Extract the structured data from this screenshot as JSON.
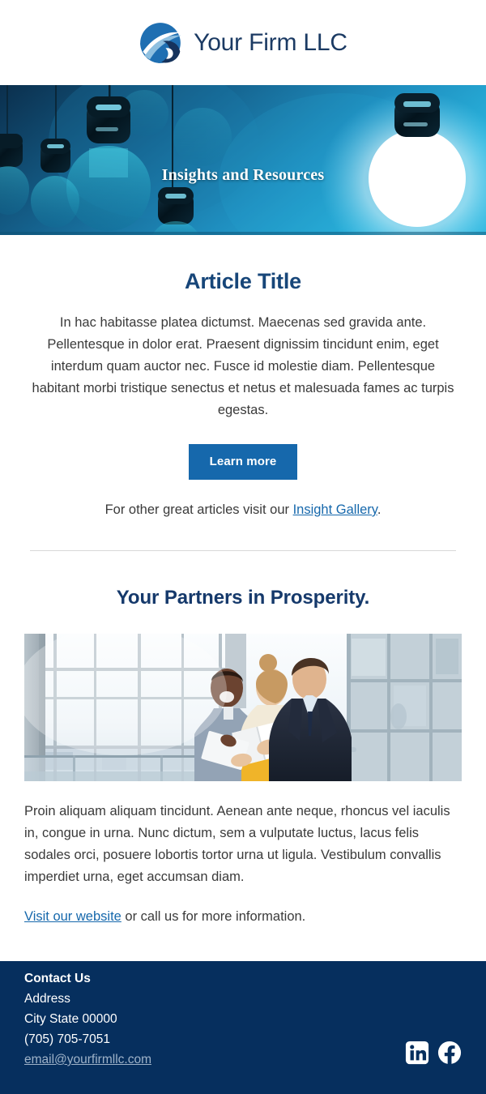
{
  "brand": {
    "name": "Your Firm LLC",
    "logo_icon": "swoosh-circle-logo-icon",
    "navy": "#1b3a63",
    "accent_blue": "#1668ac",
    "footer_navy": "#062f5e"
  },
  "hero": {
    "title": "Insights and Resources",
    "image_alt": "hanging-lightbulbs-photo",
    "background_color": "#0d3f63"
  },
  "article": {
    "title": "Article Title",
    "body": "In hac habitasse platea dictumst. Maecenas sed gravida ante. Pellentesque in dolor erat. Praesent dignissim tincidunt enim, eget interdum quam auctor nec. Fusce id molestie diam. Pellentesque habitant morbi tristique senectus et netus et malesuada fames ac turpis egestas.",
    "cta_label": "Learn more",
    "gallery_prefix": "For other great articles visit our ",
    "gallery_link_label": "Insight Gallery",
    "gallery_suffix": "."
  },
  "partners": {
    "title": "Your Partners in Prosperity.",
    "image_alt": "three-business-colleagues-reviewing-document-photo",
    "body": "Proin aliquam aliquam tincidunt. Aenean ante neque, rhoncus vel iaculis in, congue in urna. Nunc dictum, sem a vulputate luctus, lacus felis sodales orci, posuere lobortis tortor urna ut ligula. Vestibulum convallis imperdiet urna, eget accumsan diam.",
    "website_link_label": "Visit our website",
    "website_suffix": " or call us for more information."
  },
  "footer": {
    "heading": "Contact Us",
    "address": "Address",
    "city_state_zip": "City State 00000",
    "phone": "(705) 705-7051",
    "email": "email@yourfirmllc.com",
    "socials": [
      {
        "name": "linkedin-icon",
        "label": "LinkedIn"
      },
      {
        "name": "facebook-icon",
        "label": "Facebook"
      }
    ]
  }
}
